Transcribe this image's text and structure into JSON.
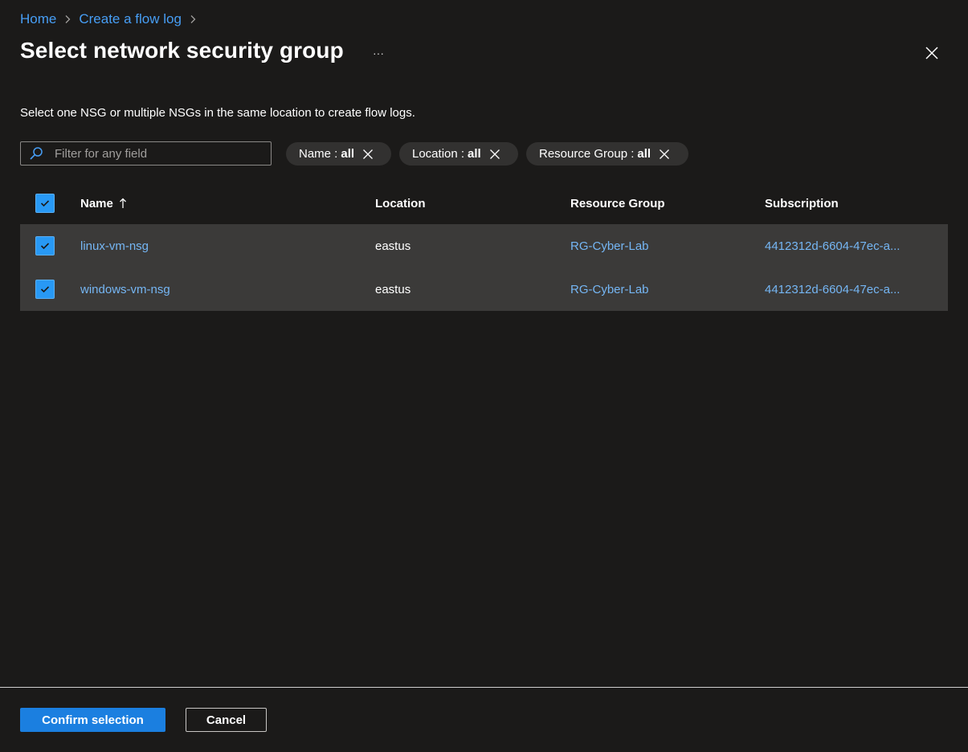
{
  "breadcrumb": {
    "items": [
      {
        "label": "Home"
      },
      {
        "label": "Create a flow log"
      }
    ]
  },
  "page": {
    "title": "Select network security group",
    "more_label": "···",
    "description": "Select one NSG or multiple NSGs in the same location to create flow logs."
  },
  "filter": {
    "placeholder": "Filter for any field",
    "value": ""
  },
  "pills": [
    {
      "label": "Name : ",
      "value": "all"
    },
    {
      "label": "Location : ",
      "value": "all"
    },
    {
      "label": "Resource Group : ",
      "value": "all"
    }
  ],
  "table": {
    "columns": [
      "Name",
      "Location",
      "Resource Group",
      "Subscription"
    ],
    "sort_column": "Name",
    "sort_direction": "ascending",
    "select_all_checked": true,
    "rows": [
      {
        "checked": true,
        "name": "linux-vm-nsg",
        "location": "eastus",
        "resource_group": "RG-Cyber-Lab",
        "subscription": "4412312d-6604-47ec-a..."
      },
      {
        "checked": true,
        "name": "windows-vm-nsg",
        "location": "eastus",
        "resource_group": "RG-Cyber-Lab",
        "subscription": "4412312d-6604-47ec-a..."
      }
    ]
  },
  "footer": {
    "confirm_label": "Confirm selection",
    "cancel_label": "Cancel"
  },
  "colors": {
    "background": "#1b1a19",
    "link": "#479ef5",
    "primary_button": "#1b7fe0",
    "checkbox": "#2899f5",
    "selected_row": "#3b3a39",
    "pill": "#323130"
  },
  "icons": {
    "breadcrumb_separator": "chevron-right-icon",
    "close": "close-icon",
    "search": "search-icon",
    "pill_remove": "dismiss-icon",
    "sort": "arrow-up-icon",
    "checkbox": "checkmark-icon"
  }
}
